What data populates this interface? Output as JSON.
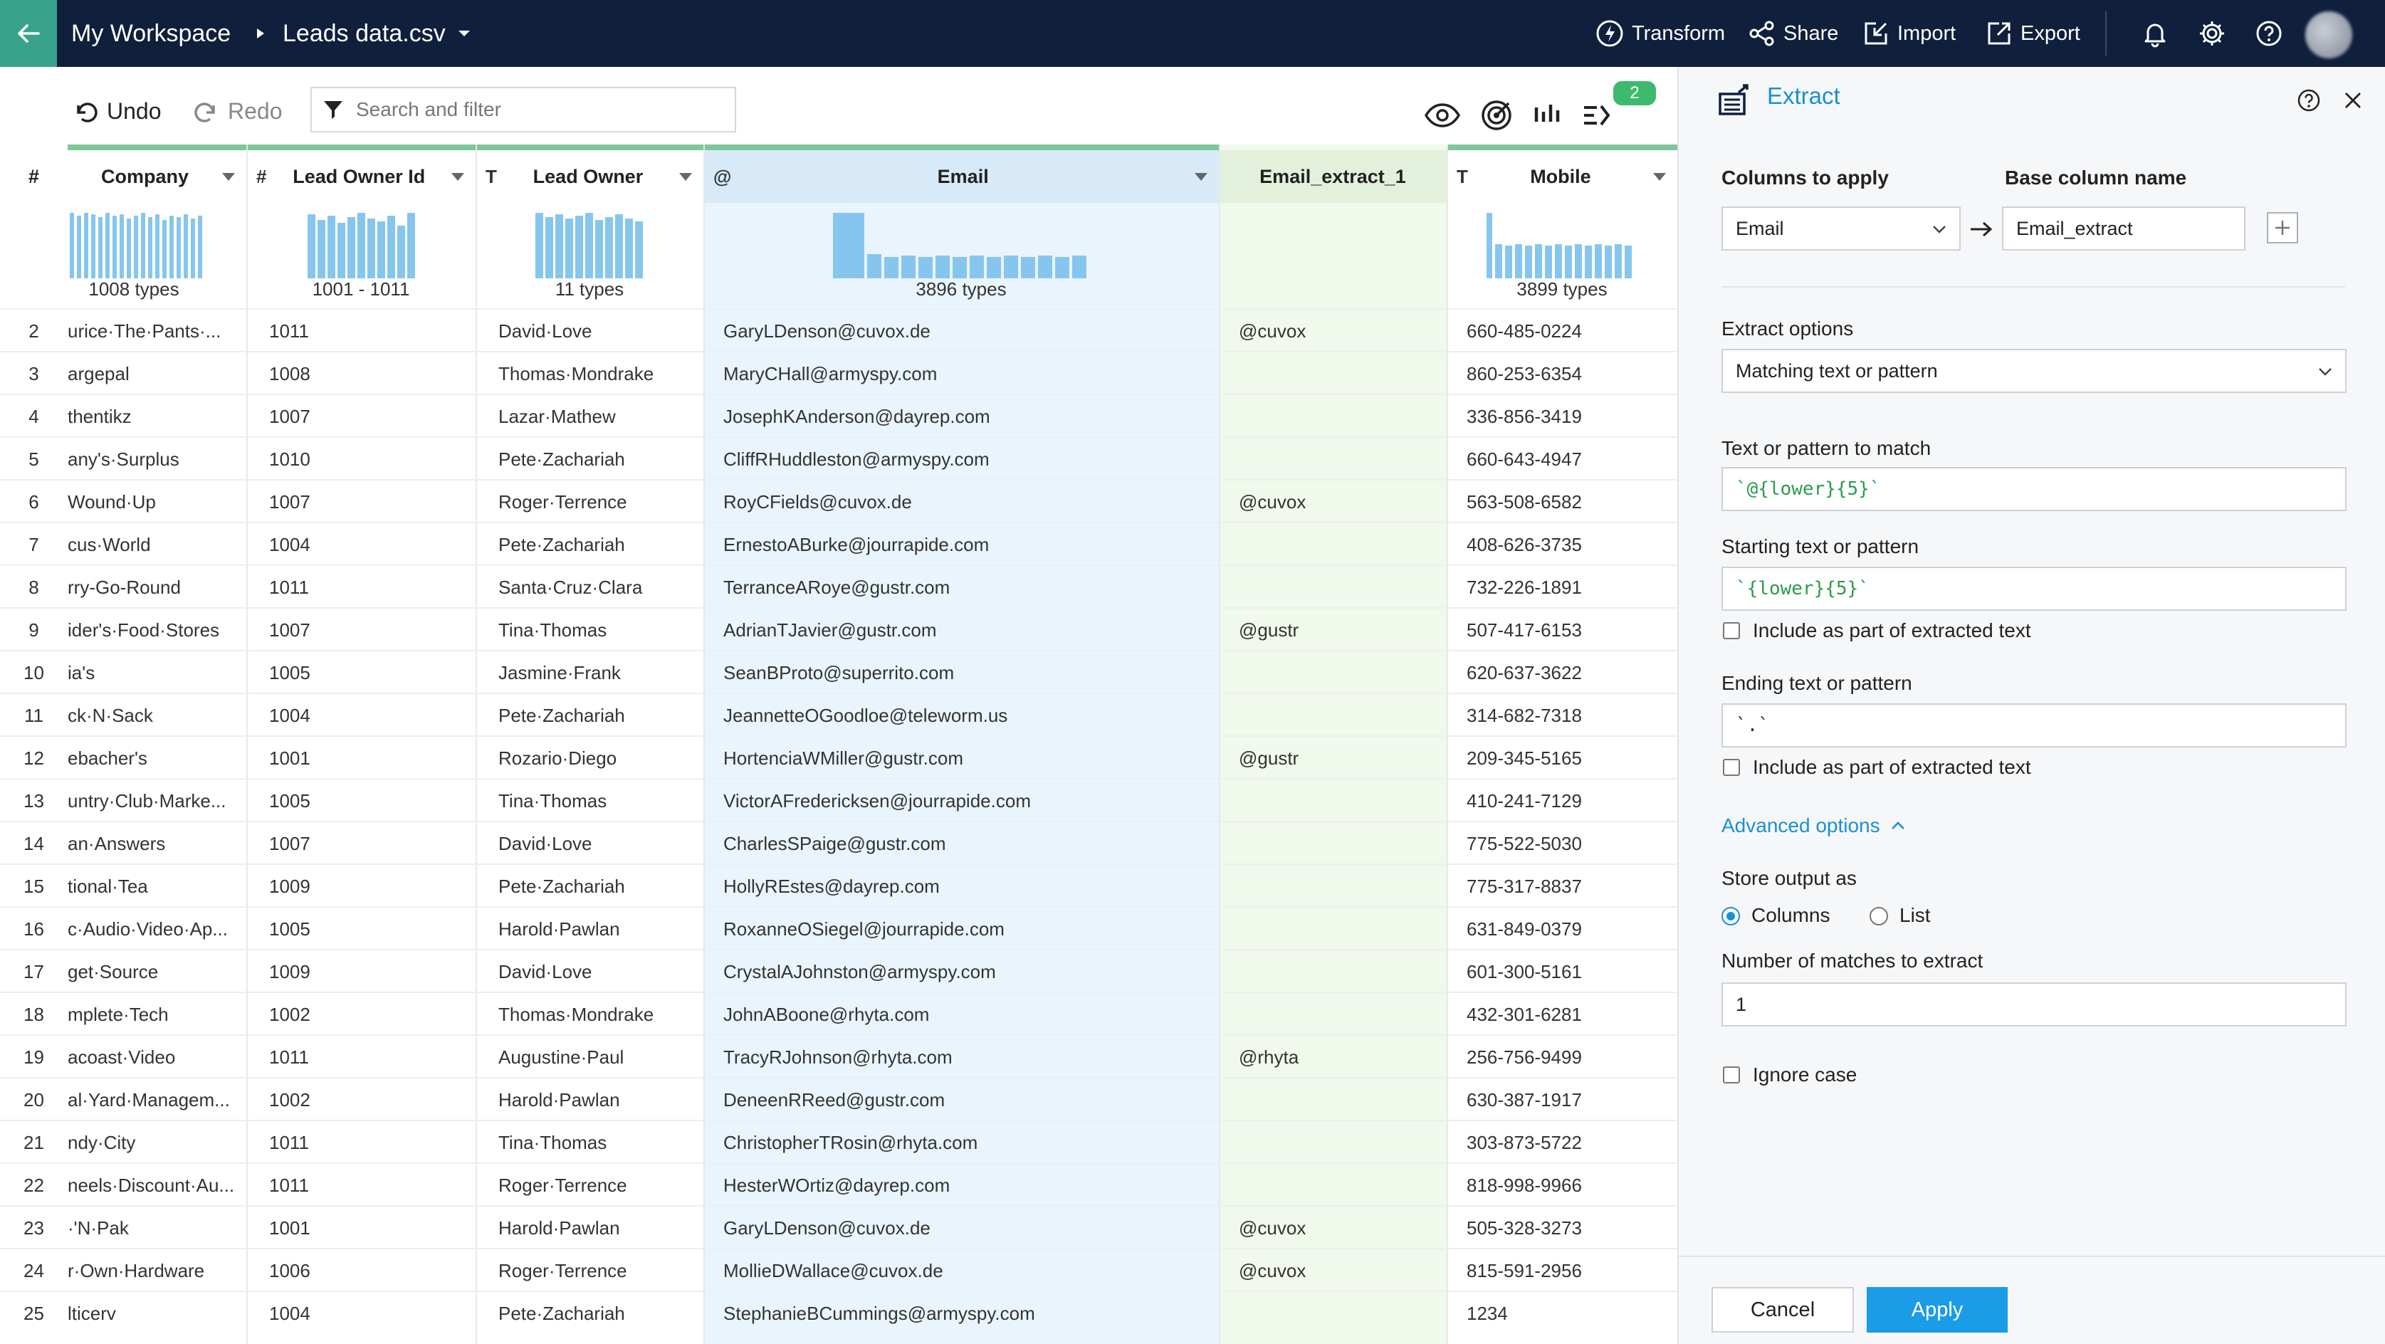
{
  "topbar": {
    "workspace": "My Workspace",
    "file": "Leads data.csv",
    "actions": {
      "transform": "Transform",
      "share": "Share",
      "import": "Import",
      "export": "Export"
    }
  },
  "toolbar": {
    "undo": "Undo",
    "redo": "Redo",
    "search_placeholder": "Search and filter",
    "notification_count": "2"
  },
  "grid": {
    "rownum_header": "#",
    "columns": [
      {
        "type_icon": "",
        "label": "Company",
        "stat": "1008 types"
      },
      {
        "type_icon": "#",
        "label": "Lead Owner Id",
        "stat": "1001 - 1011"
      },
      {
        "type_icon": "T",
        "label": "Lead Owner",
        "stat": "11 types"
      },
      {
        "type_icon": "@",
        "label": "Email",
        "stat": "3896 types"
      },
      {
        "type_icon": "",
        "label": "Email_extract_1",
        "stat": ""
      },
      {
        "type_icon": "T",
        "label": "Mobile",
        "stat": "3899 types"
      }
    ],
    "rows": [
      [
        "2",
        "urice·The·Pants·...",
        "1011",
        "David·Love",
        "GaryLDenson@cuvox.de",
        "@cuvox",
        "660-485-0224"
      ],
      [
        "3",
        "argepal",
        "1008",
        "Thomas·Mondrake",
        "MaryCHall@armyspy.com",
        "",
        "860-253-6354"
      ],
      [
        "4",
        "thentikz",
        "1007",
        "Lazar·Mathew",
        "JosephKAnderson@dayrep.com",
        "",
        "336-856-3419"
      ],
      [
        "5",
        "any's·Surplus",
        "1010",
        "Pete·Zachariah",
        "CliffRHuddleston@armyspy.com",
        "",
        "660-643-4947"
      ],
      [
        "6",
        "Wound·Up",
        "1007",
        "Roger·Terrence",
        "RoyCFields@cuvox.de",
        "@cuvox",
        "563-508-6582"
      ],
      [
        "7",
        "cus·World",
        "1004",
        "Pete·Zachariah",
        "ErnestoABurke@jourrapide.com",
        "",
        "408-626-3735"
      ],
      [
        "8",
        "rry-Go-Round",
        "1011",
        "Santa·Cruz·Clara",
        "TerranceARoye@gustr.com",
        "",
        "732-226-1891"
      ],
      [
        "9",
        "ider's·Food·Stores",
        "1007",
        "Tina·Thomas",
        "AdrianTJavier@gustr.com",
        "@gustr",
        "507-417-6153"
      ],
      [
        "10",
        "ia's",
        "1005",
        "Jasmine·Frank",
        "SeanBProto@superrito.com",
        "",
        "620-637-3622"
      ],
      [
        "11",
        "ck·N·Sack",
        "1004",
        "Pete·Zachariah",
        "JeannetteOGoodloe@teleworm.us",
        "",
        "314-682-7318"
      ],
      [
        "12",
        "ebacher's",
        "1001",
        "Rozario·Diego",
        "HortenciaWMiller@gustr.com",
        "@gustr",
        "209-345-5165"
      ],
      [
        "13",
        "untry·Club·Marke...",
        "1005",
        "Tina·Thomas",
        "VictorAFredericksen@jourrapide.com",
        "",
        "410-241-7129"
      ],
      [
        "14",
        "an·Answers",
        "1007",
        "David·Love",
        "CharlesSPaige@gustr.com",
        "",
        "775-522-5030"
      ],
      [
        "15",
        "tional·Tea",
        "1009",
        "Pete·Zachariah",
        "HollyREstes@dayrep.com",
        "",
        "775-317-8837"
      ],
      [
        "16",
        "c·Audio·Video·Ap...",
        "1005",
        "Harold·Pawlan",
        "RoxanneOSiegel@jourrapide.com",
        "",
        "631-849-0379"
      ],
      [
        "17",
        "get·Source",
        "1009",
        "David·Love",
        "CrystalAJohnston@armyspy.com",
        "",
        "601-300-5161"
      ],
      [
        "18",
        "mplete·Tech",
        "1002",
        "Thomas·Mondrake",
        "JohnABoone@rhyta.com",
        "",
        "432-301-6281"
      ],
      [
        "19",
        "acoast·Video",
        "1011",
        "Augustine·Paul",
        "TracyRJohnson@rhyta.com",
        "@rhyta",
        "256-756-9499"
      ],
      [
        "20",
        "al·Yard·Managem...",
        "1002",
        "Harold·Pawlan",
        "DeneenRReed@gustr.com",
        "",
        "630-387-1917"
      ],
      [
        "21",
        "ndy·City",
        "1011",
        "Tina·Thomas",
        "ChristopherTRosin@rhyta.com",
        "",
        "303-873-5722"
      ],
      [
        "22",
        "neels·Discount·Au...",
        "1011",
        "Roger·Terrence",
        "HesterWOrtiz@dayrep.com",
        "",
        "818-998-9966"
      ],
      [
        "23",
        "·'N·Pak",
        "1001",
        "Harold·Pawlan",
        "GaryLDenson@cuvox.de",
        "@cuvox",
        "505-328-3273"
      ],
      [
        "24",
        "r·Own·Hardware",
        "1006",
        "Roger·Terrence",
        "MollieDWallace@cuvox.de",
        "@cuvox",
        "815-591-2956"
      ],
      [
        "25",
        "lticerv",
        "1004",
        "Pete·Zachariah",
        "StephanieBCummings@armyspy.com",
        "",
        "1234"
      ]
    ]
  },
  "panel": {
    "title": "Extract",
    "columns_to_apply_label": "Columns to apply",
    "base_column_name_label": "Base column name",
    "column_value": "Email",
    "base_column_value": "Email_extract",
    "extract_options_label": "Extract options",
    "extract_options_value": "Matching text or pattern",
    "pattern_label": "Text or pattern to match",
    "pattern_value": "`@{lower}{5}`",
    "start_label": "Starting text or pattern",
    "start_value": "`{lower}{5}`",
    "include_label_1": "Include as part of extracted text",
    "end_label": "Ending text or pattern",
    "end_value": "`.`",
    "include_label_2": "Include as part of extracted text",
    "advanced_label": "Advanced options",
    "store_output_label": "Store output as",
    "option_columns": "Columns",
    "option_list": "List",
    "matches_label": "Number of matches to extract",
    "matches_value": "1",
    "ignore_case_label": "Ignore case",
    "cancel_label": "Cancel",
    "apply_label": "Apply"
  }
}
